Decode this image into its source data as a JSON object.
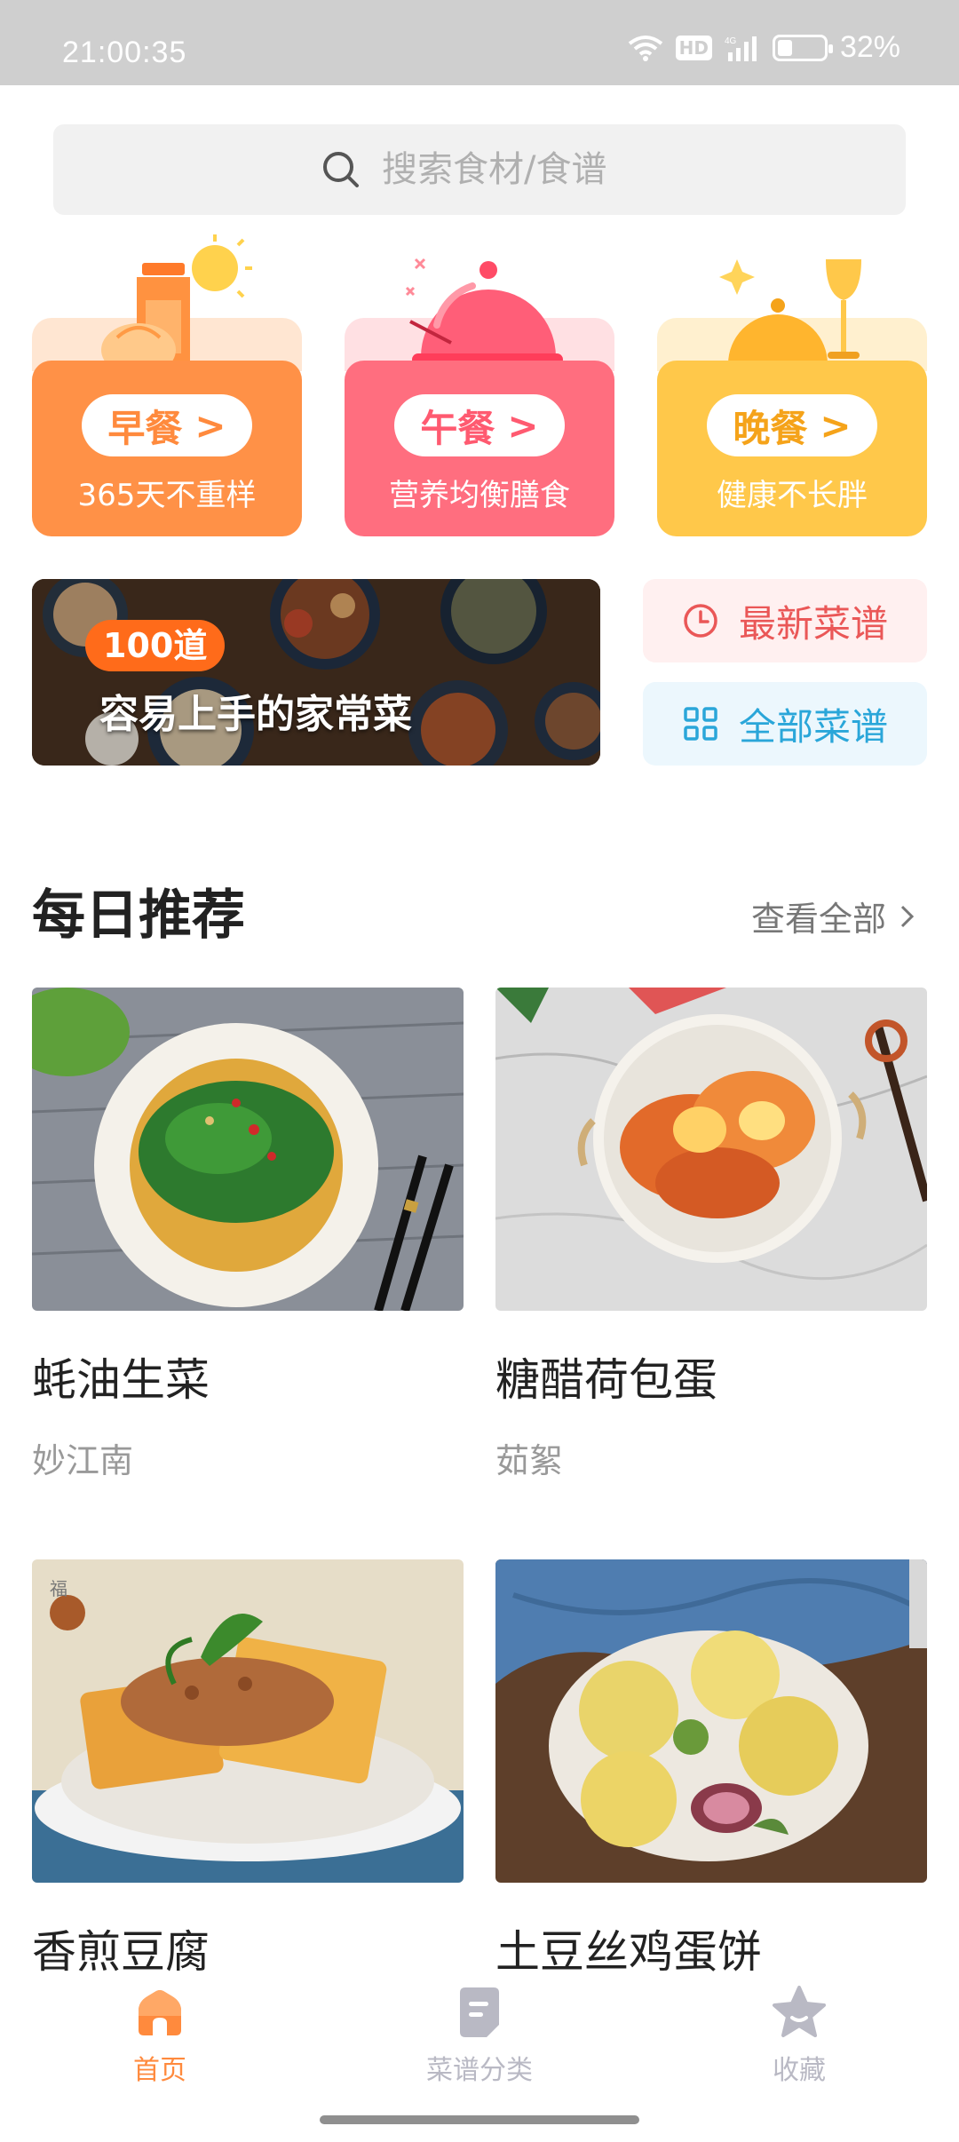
{
  "status_bar": {
    "time": "21:00:35",
    "battery": "32%",
    "battery_level": 0.32,
    "network": "4G",
    "hd": "HD"
  },
  "search": {
    "placeholder": "搜索食材/食谱"
  },
  "meals": [
    {
      "title": "早餐",
      "subtitle": "365天不重样",
      "color": "#ff9147",
      "back_color": "#ffe6d2",
      "text_color": "#ff8a3d"
    },
    {
      "title": "午餐",
      "subtitle": "营养均衡膳食",
      "color": "#ff6e7f",
      "back_color": "#ffe0e3",
      "text_color": "#ff5a70"
    },
    {
      "title": "晚餐",
      "subtitle": "健康不长胖",
      "color": "#ffc84a",
      "back_color": "#fff0cf",
      "text_color": "#f5a31a"
    }
  ],
  "banner": {
    "badge": "100道",
    "text": "容易上手的家常菜"
  },
  "quick_links": [
    {
      "label": "最新菜谱",
      "icon": "clock-icon",
      "bg": "#fff0f0",
      "color": "#ea5757"
    },
    {
      "label": "全部菜谱",
      "icon": "grid-icon",
      "bg": "#ecf7fd",
      "color": "#2aa6d9"
    }
  ],
  "daily": {
    "title": "每日推荐",
    "see_all": "查看全部",
    "recipes": [
      {
        "name": "蚝油生菜",
        "author": "妙江南"
      },
      {
        "name": "糖醋荷包蛋",
        "author": "茹絮"
      },
      {
        "name": "香煎豆腐",
        "author": ""
      },
      {
        "name": "土豆丝鸡蛋饼",
        "author": ""
      }
    ]
  },
  "nav": [
    {
      "label": "首页",
      "icon": "home-icon",
      "active": true
    },
    {
      "label": "菜谱分类",
      "icon": "book-icon",
      "active": false
    },
    {
      "label": "收藏",
      "icon": "star-icon",
      "active": false
    }
  ],
  "colors": {
    "accent": "#ff8a3d",
    "nav_inactive": "#b9b9c4"
  }
}
